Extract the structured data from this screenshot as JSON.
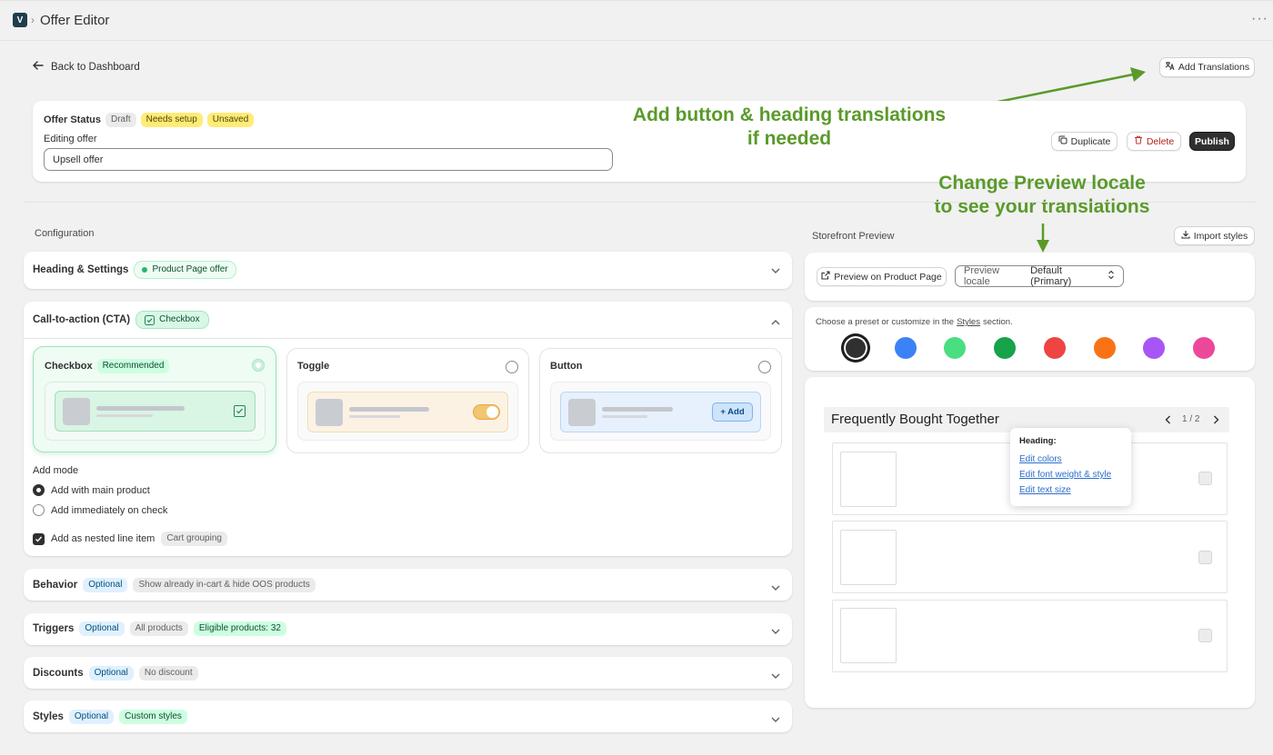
{
  "header": {
    "logo_glyph": "V",
    "title": "Offer Editor",
    "crumb_sep": "›",
    "more": "···"
  },
  "nav": {
    "back_label": "Back to Dashboard",
    "add_translations": "Add Translations"
  },
  "status": {
    "label": "Offer Status",
    "badges": [
      "Draft",
      "Needs setup",
      "Unsaved"
    ],
    "editing_label": "Editing offer",
    "offer_name": "Upsell offer",
    "duplicate": "Duplicate",
    "delete": "Delete",
    "publish": "Publish"
  },
  "annotations": {
    "translations_line1": "Add button & heading translations",
    "translations_line2": "if needed",
    "locale_line1": "Change Preview locale",
    "locale_line2": "to see your translations",
    "arrow_color": "#5a9a2a"
  },
  "config": {
    "title": "Configuration",
    "heading_settings": {
      "label": "Heading & Settings",
      "badge": "Product Page offer"
    },
    "cta": {
      "label": "Call-to-action (CTA)",
      "badge": "Checkbox",
      "options": [
        {
          "label": "Checkbox",
          "badge": "Recommended",
          "selected": true
        },
        {
          "label": "Toggle",
          "selected": false
        },
        {
          "label": "Button",
          "selected": false,
          "button_label": "+ Add"
        }
      ],
      "add_mode_label": "Add mode",
      "add_modes": [
        {
          "label": "Add with main product",
          "selected": true
        },
        {
          "label": "Add immediately on check",
          "selected": false
        }
      ],
      "nested_label": "Add as nested line item",
      "nested_badge": "Cart grouping",
      "nested_checked": true
    },
    "behavior": {
      "label": "Behavior",
      "optional": "Optional",
      "info": "Show already in-cart & hide OOS products"
    },
    "triggers": {
      "label": "Triggers",
      "optional": "Optional",
      "info": "All products",
      "eligible": "Eligible products: 32"
    },
    "discounts": {
      "label": "Discounts",
      "optional": "Optional",
      "info": "No discount"
    },
    "styles": {
      "label": "Styles",
      "optional": "Optional",
      "info": "Custom styles"
    }
  },
  "preview": {
    "title": "Storefront Preview",
    "import_styles": "Import styles",
    "preview_on_product": "Preview on Product Page",
    "locale_label": "Preview locale",
    "locale_value": "Default (Primary)",
    "preset_text_before": "Choose a preset or customize in the",
    "preset_link": "Styles",
    "preset_text_after": "section.",
    "swatches": [
      "#303030",
      "#3b82f6",
      "#4ade80",
      "#16a34a",
      "#ef4444",
      "#f97316",
      "#a855f7",
      "#ec4899"
    ],
    "widget_heading": "Frequently Bought Together",
    "pager": "1 / 2",
    "popover": {
      "title": "Heading:",
      "links": [
        "Edit colors",
        "Edit font weight & style",
        "Edit text size"
      ]
    }
  }
}
